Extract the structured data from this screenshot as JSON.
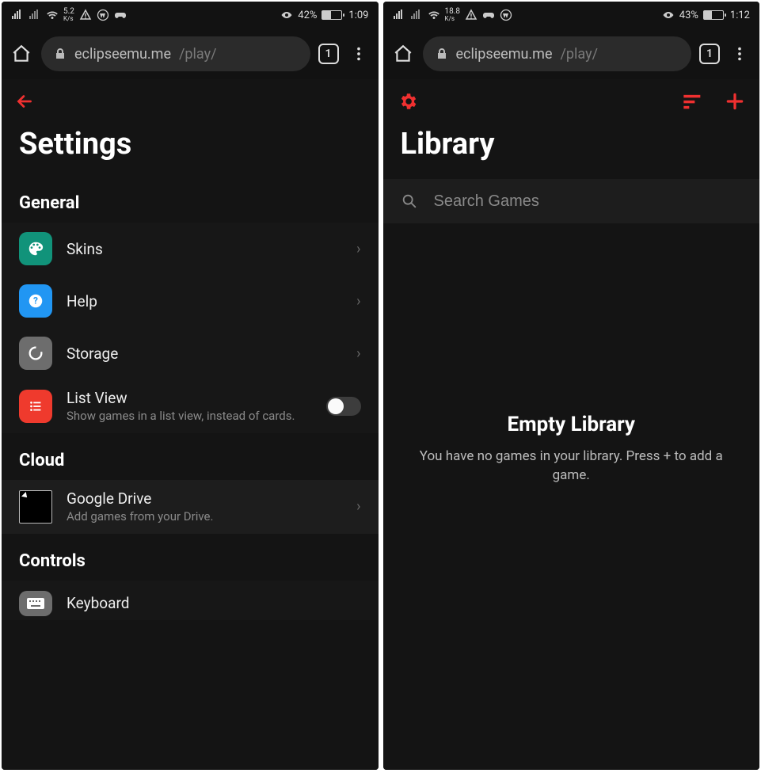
{
  "left": {
    "status": {
      "speed_num": "5.2",
      "speed_unit": "K/s",
      "battery_pct": "42%",
      "time": "1:09",
      "batt_fill": 42
    },
    "browser": {
      "url_host": "eclipseemu.me",
      "url_path": "/play/",
      "tab_count": "1"
    },
    "page_title": "Settings",
    "sections": {
      "general": {
        "header": "General",
        "skins": "Skins",
        "help": "Help",
        "storage": "Storage",
        "listview_label": "List View",
        "listview_sub": "Show games in a list view, instead of cards.",
        "listview_on": false
      },
      "cloud": {
        "header": "Cloud",
        "gdrive_label": "Google Drive",
        "gdrive_sub": "Add games from your Drive."
      },
      "controls": {
        "header": "Controls",
        "keyboard": "Keyboard"
      }
    }
  },
  "right": {
    "status": {
      "speed_num": "18.8",
      "speed_unit": "K/s",
      "battery_pct": "43%",
      "time": "1:12",
      "batt_fill": 43
    },
    "browser": {
      "url_host": "eclipseemu.me",
      "url_path": "/play/",
      "tab_count": "1"
    },
    "page_title": "Library",
    "search_placeholder": "Search Games",
    "empty_heading": "Empty Library",
    "empty_sub": "You have no games in your library. Press + to add a game."
  }
}
